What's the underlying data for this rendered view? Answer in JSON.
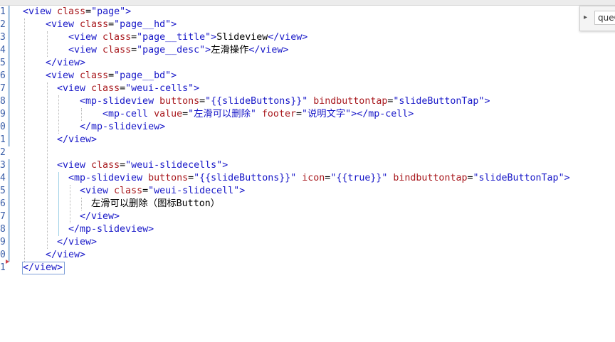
{
  "find_widget": {
    "query": "queO",
    "toggle_icon": "chevron-right-icon"
  },
  "line_numbers": [
    "1",
    "2",
    "3",
    "4",
    "5",
    "6",
    "7",
    "8",
    "9",
    "0",
    "1",
    "2",
    "3",
    "4",
    "5",
    "6",
    "7",
    "8",
    "9",
    "0",
    "1"
  ],
  "code_lines": [
    [
      {
        "t": "tag",
        "v": "<view "
      },
      {
        "t": "attr",
        "v": "class"
      },
      {
        "t": "txt",
        "v": "="
      },
      {
        "t": "val",
        "v": "\"page\""
      },
      {
        "t": "tag",
        "v": ">"
      }
    ],
    [
      {
        "t": "tag",
        "v": "<view "
      },
      {
        "t": "attr",
        "v": "class"
      },
      {
        "t": "txt",
        "v": "="
      },
      {
        "t": "val",
        "v": "\"page__hd\""
      },
      {
        "t": "tag",
        "v": ">"
      }
    ],
    [
      {
        "t": "tag",
        "v": "<view "
      },
      {
        "t": "attr",
        "v": "class"
      },
      {
        "t": "txt",
        "v": "="
      },
      {
        "t": "val",
        "v": "\"page__title\""
      },
      {
        "t": "tag",
        "v": ">"
      },
      {
        "t": "txt",
        "v": "Slideview"
      },
      {
        "t": "tag",
        "v": "</view>"
      }
    ],
    [
      {
        "t": "tag",
        "v": "<view "
      },
      {
        "t": "attr",
        "v": "class"
      },
      {
        "t": "txt",
        "v": "="
      },
      {
        "t": "val",
        "v": "\"page__desc\""
      },
      {
        "t": "tag",
        "v": ">"
      },
      {
        "t": "txt",
        "v": "左滑操作"
      },
      {
        "t": "tag",
        "v": "</view>"
      }
    ],
    [
      {
        "t": "tag",
        "v": "</view>"
      }
    ],
    [
      {
        "t": "tag",
        "v": "<view "
      },
      {
        "t": "attr",
        "v": "class"
      },
      {
        "t": "txt",
        "v": "="
      },
      {
        "t": "val",
        "v": "\"page__bd\""
      },
      {
        "t": "tag",
        "v": ">"
      }
    ],
    [
      {
        "t": "tag",
        "v": "<view "
      },
      {
        "t": "attr",
        "v": "class"
      },
      {
        "t": "txt",
        "v": "="
      },
      {
        "t": "val",
        "v": "\"weui-cells\""
      },
      {
        "t": "tag",
        "v": ">"
      }
    ],
    [
      {
        "t": "tag",
        "v": "<mp-slideview "
      },
      {
        "t": "attr",
        "v": "buttons"
      },
      {
        "t": "txt",
        "v": "="
      },
      {
        "t": "val",
        "v": "\"{{slideButtons}}\""
      },
      {
        "t": "txt",
        "v": " "
      },
      {
        "t": "attr",
        "v": "bindbuttontap"
      },
      {
        "t": "txt",
        "v": "="
      },
      {
        "t": "val",
        "v": "\"slideButtonTap\""
      },
      {
        "t": "tag",
        "v": ">"
      }
    ],
    [
      {
        "t": "tag",
        "v": "<mp-cell "
      },
      {
        "t": "attr",
        "v": "value"
      },
      {
        "t": "txt",
        "v": "="
      },
      {
        "t": "val",
        "v": "\"左滑可以删除\""
      },
      {
        "t": "txt",
        "v": " "
      },
      {
        "t": "attr",
        "v": "footer"
      },
      {
        "t": "txt",
        "v": "="
      },
      {
        "t": "val",
        "v": "\"说明文字\""
      },
      {
        "t": "tag",
        "v": "></mp-cell>"
      }
    ],
    [
      {
        "t": "tag",
        "v": "</mp-slideview>"
      }
    ],
    [
      {
        "t": "tag",
        "v": "</view>"
      }
    ],
    [],
    [
      {
        "t": "tag",
        "v": "<view "
      },
      {
        "t": "attr",
        "v": "class"
      },
      {
        "t": "txt",
        "v": "="
      },
      {
        "t": "val",
        "v": "\"weui-slidecells\""
      },
      {
        "t": "tag",
        "v": ">"
      }
    ],
    [
      {
        "t": "tag",
        "v": "<mp-slideview "
      },
      {
        "t": "attr",
        "v": "buttons"
      },
      {
        "t": "txt",
        "v": "="
      },
      {
        "t": "val",
        "v": "\"{{slideButtons}}\""
      },
      {
        "t": "txt",
        "v": " "
      },
      {
        "t": "attr",
        "v": "icon"
      },
      {
        "t": "txt",
        "v": "="
      },
      {
        "t": "val",
        "v": "\"{{true}}\""
      },
      {
        "t": "txt",
        "v": " "
      },
      {
        "t": "attr",
        "v": "bindbuttontap"
      },
      {
        "t": "txt",
        "v": "="
      },
      {
        "t": "val",
        "v": "\"slideButtonTap\""
      },
      {
        "t": "tag",
        "v": ">"
      }
    ],
    [
      {
        "t": "tag",
        "v": "<view "
      },
      {
        "t": "attr",
        "v": "class"
      },
      {
        "t": "txt",
        "v": "="
      },
      {
        "t": "val",
        "v": "\"weui-slidecell\""
      },
      {
        "t": "tag",
        "v": ">"
      }
    ],
    [
      {
        "t": "txt",
        "v": "左滑可以删除（图标Button）"
      }
    ],
    [
      {
        "t": "tag",
        "v": "</view>"
      }
    ],
    [
      {
        "t": "tag",
        "v": "</mp-slideview>"
      }
    ],
    [
      {
        "t": "tag",
        "v": "</view>"
      }
    ],
    [
      {
        "t": "tag",
        "v": "</view>"
      }
    ],
    [
      {
        "t": "tag",
        "v": "</view>"
      }
    ]
  ],
  "colors": {
    "tag": "#1717c8",
    "attribute": "#a8181d",
    "value": "#1717c8",
    "text": "#000000",
    "line_number": "#3a5ea8"
  }
}
